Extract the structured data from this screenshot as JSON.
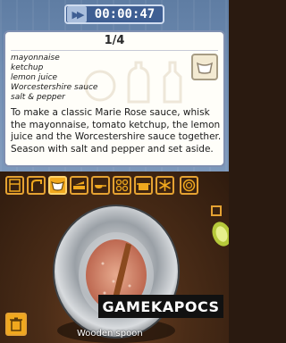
{
  "timer": {
    "value": "00:00:47"
  },
  "recipe_card": {
    "step": "1/4",
    "ingredients": [
      "mayonnaise",
      "ketchup",
      "lemon juice",
      "Worcestershire sauce",
      "salt & pepper"
    ],
    "instruction": "To make a classic Marie Rose sauce, whisk the mayonnaise, tomato ketchup, the lemon juice and the Worcestershire sauce together. Season with salt and pepper and set aside.",
    "badge_icon": "bowl-icon"
  },
  "toolbar": {
    "tools": [
      "fridge-icon",
      "faucet-icon",
      "bowl-icon",
      "knife-board-icon",
      "pan-icon",
      "stove-burners-icon",
      "pot-icon",
      "freezer-snowflake-icon",
      "plate-icon"
    ],
    "selected": "bowl-icon"
  },
  "workspace": {
    "current_tool_label": "Wooden spoon",
    "trash_icon": "trash-icon"
  },
  "watermark": "GAMEKAPOCS",
  "colors": {
    "accent": "#f0a81e",
    "top_bg": "#6d8ab0",
    "card_bg": "#fffef9",
    "sauce": "#d8917a"
  }
}
